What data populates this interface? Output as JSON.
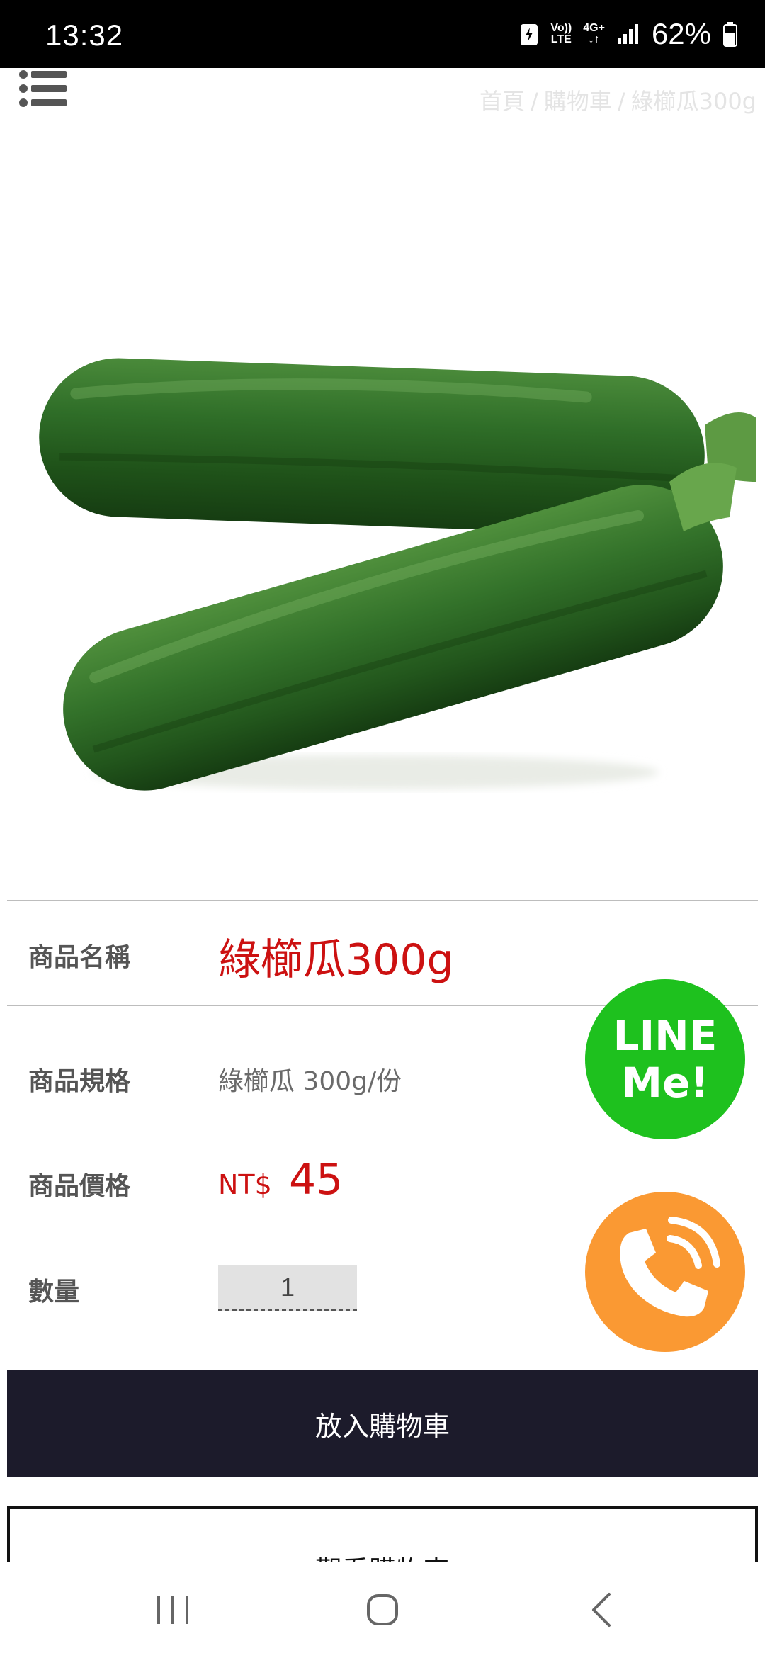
{
  "status_bar": {
    "time": "13:32",
    "network_top": "Vo))",
    "network_bottom": "LTE",
    "network_type": "4G+",
    "battery": "62%"
  },
  "header": {
    "menu_icon": "list-icon",
    "breadcrumb": [
      "首頁",
      "購物車",
      "綠櫛瓜300g"
    ],
    "breadcrumb_separator": "/"
  },
  "product": {
    "image": "zucchini-photo",
    "name_label": "商品名稱",
    "name": "綠櫛瓜300g",
    "spec_label": "商品規格",
    "spec": "綠櫛瓜 300g/份",
    "price_label": "商品價格",
    "currency": "NT$",
    "price": "45",
    "quantity_label": "數量",
    "quantity": "1"
  },
  "floating": {
    "line_line1": "LINE",
    "line_line2": "Me!",
    "line_color": "#1ec11e",
    "call_icon": "phone-call-icon",
    "call_color": "#fa9933"
  },
  "actions": {
    "add_to_cart": "放入購物車",
    "view_cart": "觀看購物車"
  },
  "colors": {
    "accent_red": "#cc1111",
    "button_dark": "#1c1b2b"
  }
}
